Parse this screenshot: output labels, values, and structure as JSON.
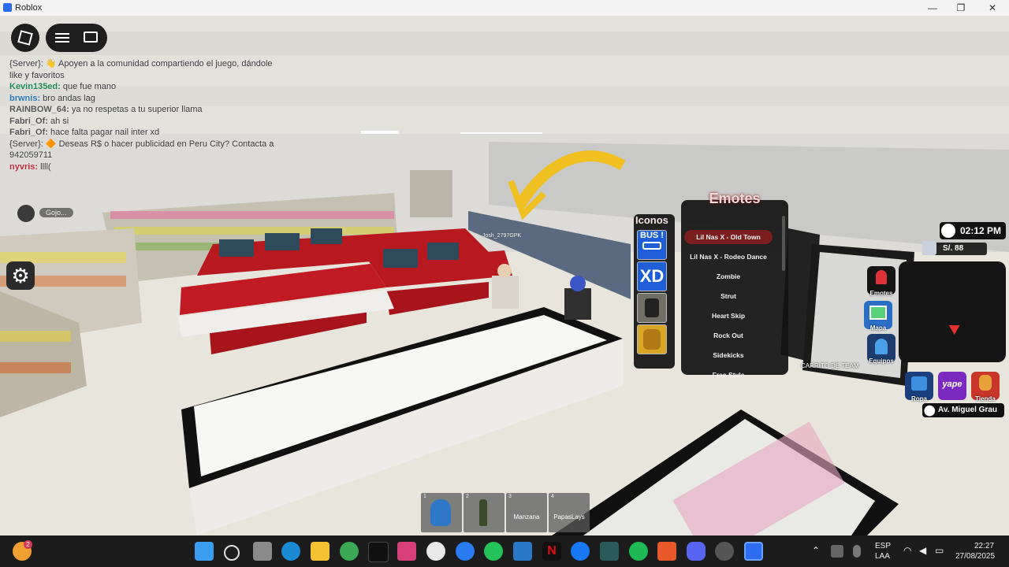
{
  "window": {
    "title": "Roblox",
    "minimize": "—",
    "maximize": "❐",
    "close": "✕",
    "accent": "#2b6cf0"
  },
  "chat": {
    "lines": [
      {
        "name": "",
        "text": "{Server}: 👋 Apoyen a la comunidad compartiendo el juego, dándole",
        "color": "#3a3a3a"
      },
      {
        "name": "",
        "text": "like y favoritos",
        "color": "#3a3a3a"
      },
      {
        "name": "Kevin135ed:",
        "text": " que fue mano",
        "color": "#1e8a55"
      },
      {
        "name": "brwnis:",
        "text": " bro andas lag",
        "color": "#2a74b8"
      },
      {
        "name": "RAINBOW_64:",
        "text": " ya no respetas a tu superior llama",
        "color": "#555555"
      },
      {
        "name": "Fabri_Of:",
        "text": " ah si",
        "color": "#555555"
      },
      {
        "name": "Fabri_Of:",
        "text": " hace falta pagar nail inter xd",
        "color": "#555555"
      },
      {
        "name": "",
        "text": "{Server}: 🔶 Deseas R$ o hacer publicidad en Peru City? Contacta a",
        "color": "#3a3a3a"
      },
      {
        "name": "",
        "text": "942059711",
        "color": "#3a3a3a"
      },
      {
        "name": "nyvris:",
        "text": " llll(",
        "color": "#c4283c"
      }
    ]
  },
  "world": {
    "player_tag": "Gojo...",
    "counter_text": "Josh_2797GPK",
    "sign_text": "CARRITO DE TEAM"
  },
  "emotes": {
    "title": "Emotes",
    "items": [
      "Lil Nas X - Old Town",
      "Lil Nas X - Rodeo Dance",
      "Zombie",
      "Strut",
      "Heart Skip",
      "Rock Out",
      "Sidekicks",
      "Free Style"
    ],
    "selected_index": 0
  },
  "iconos": {
    "title": "Iconos",
    "items": [
      "BUS !",
      "XD",
      "",
      ""
    ]
  },
  "hud": {
    "time": "02:12 PM",
    "money": "S/. 88",
    "street": "Av. Miguel Grau",
    "buttons": [
      "Emotes",
      "Mapa",
      "Equipos",
      "Ropa",
      "yape",
      "Tienda"
    ]
  },
  "hotbar": [
    {
      "num": "1",
      "label": ""
    },
    {
      "num": "2",
      "label": ""
    },
    {
      "num": "3",
      "label": "Manzana"
    },
    {
      "num": "4",
      "label": "PapasLays"
    }
  ],
  "taskbar": {
    "badge": "2",
    "lang": "ESP",
    "lang2": "LAA",
    "time": "22:27",
    "date": "27/08/2025"
  }
}
